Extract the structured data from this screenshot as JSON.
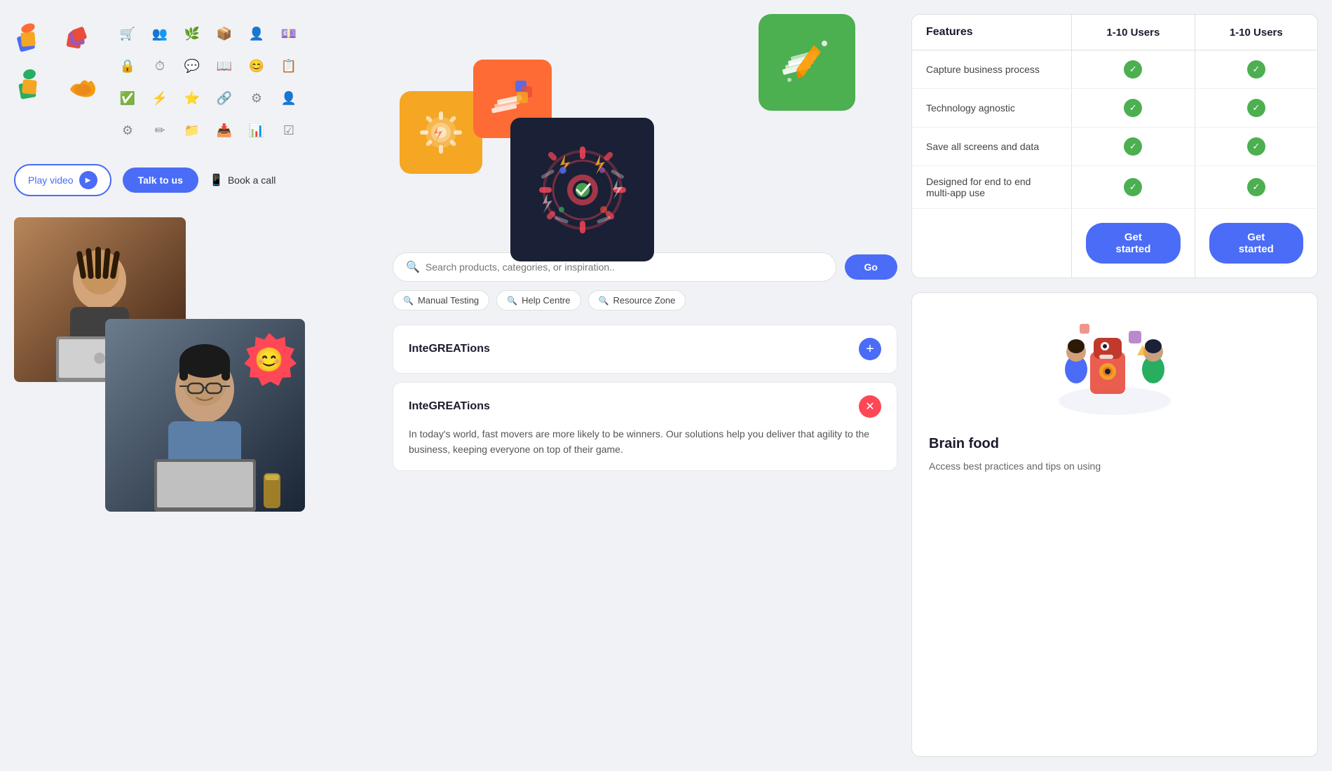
{
  "page": {
    "background": "#f0f2f5"
  },
  "left": {
    "play_video_label": "Play video",
    "talk_us_label": "Talk to us",
    "book_call_label": "Book a call"
  },
  "middle": {
    "search": {
      "placeholder": "Search products, categories, or inspiration..",
      "go_label": "Go"
    },
    "tags": [
      {
        "label": "Manual Testing"
      },
      {
        "label": "Help Centre"
      },
      {
        "label": "Resource Zone"
      }
    ],
    "accordion": [
      {
        "id": "accord-1",
        "title": "InteGREATions",
        "state": "collapsed",
        "body": ""
      },
      {
        "id": "accord-2",
        "title": "InteGREATions",
        "state": "expanded",
        "body": "In today's world, fast movers are more likely to be winners. Our solutions help you deliver that agility to the business, keeping everyone on top of their game."
      }
    ]
  },
  "right": {
    "pricing": {
      "features_label": "Features",
      "col1_label": "1-10 Users",
      "col2_label": "1-10 Users",
      "rows": [
        {
          "feature": "Capture business process",
          "col1": true,
          "col2": true
        },
        {
          "feature": "Technology agnostic",
          "col1": true,
          "col2": true
        },
        {
          "feature": "Save all screens and data",
          "col1": true,
          "col2": true
        },
        {
          "feature": "Designed for end to end multi-app use",
          "col1": true,
          "col2": true
        }
      ],
      "get_started_label": "Get started"
    },
    "brain_food": {
      "title": "Brain food",
      "description": "Access best practices and tips on using"
    }
  },
  "icons": {
    "outline_icons": [
      "🛒",
      "👥",
      "🌿",
      "📦",
      "👤",
      "💷",
      "🔒",
      "⏱",
      "💬",
      "📖",
      "😊",
      "📋",
      "✅",
      "⚡",
      "⭐",
      "🔗",
      "⚙",
      "👤",
      "⚙",
      "✏",
      "📁",
      "📥",
      "📊",
      "☑"
    ]
  }
}
